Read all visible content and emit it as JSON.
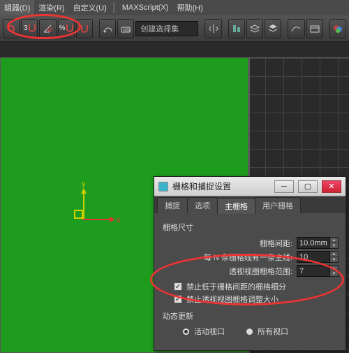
{
  "menubar": {
    "items": [
      "辑器(D)",
      "渲染(R)",
      "自定义(U)",
      "MAXScript(X)",
      "帮助(H)"
    ]
  },
  "toolbar": {
    "snap3_label": "3",
    "percent_label": "%",
    "selection_input": "创建选择集"
  },
  "axis": {
    "x": "x",
    "y": "y"
  },
  "dialog": {
    "title": "栅格和捕捉设置",
    "tabs": [
      "捕捉",
      "选项",
      "主栅格",
      "用户栅格"
    ],
    "group_title": "栅格尺寸",
    "rows": {
      "spacing": {
        "label": "栅格间距:",
        "value": "10.0mm"
      },
      "nth": {
        "label": "每 N 条栅格线有一条主线:",
        "value": "10"
      },
      "persp": {
        "label": "透视视图栅格范围:",
        "value": "7"
      }
    },
    "chk1": "禁止低于栅格间距的栅格细分",
    "chk2": "禁止透视视图栅格调整大小",
    "dyn_title": "动态更新",
    "radio_active": "活动视口",
    "radio_all": "所有视口"
  }
}
